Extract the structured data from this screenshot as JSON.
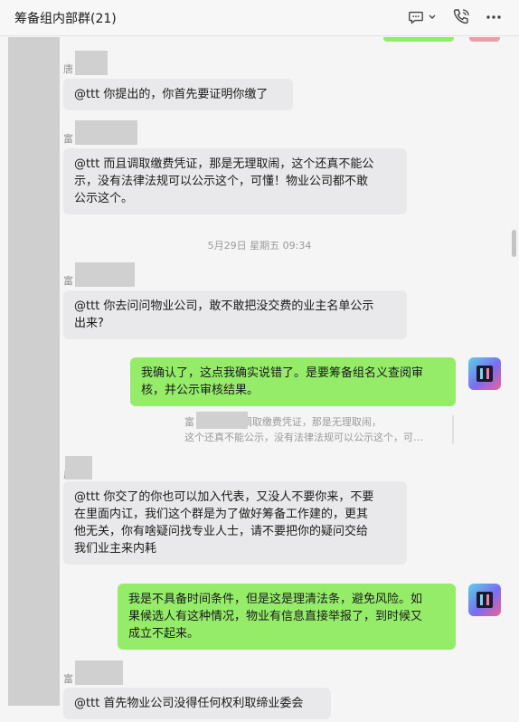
{
  "header": {
    "title": "筹备组内部群(21)"
  },
  "messages": {
    "m1": {
      "sender": "唐",
      "text": "@ttt 你提出的，你首先要证明你缴了"
    },
    "m2": {
      "sender": "富",
      "text": "@ttt 而且调取缴费凭证，那是无理取闹，这个还真不能公\n示，没有法律法规可以公示这个，可懂！物业公司都不敢\n公示这个。"
    },
    "ts": "5月29日 星期五 09:34",
    "m3": {
      "sender": "富",
      "text": "@ttt 你去问问物业公司，敢不敢把没交费的业主名单公示\n出来?"
    },
    "m4": {
      "text": "我确认了，这点我确实说错了。是要筹备组名义查阅审\n核，并公示审核结果。"
    },
    "q4": {
      "sender": "富",
      "text": "@ttt 而且调取缴费凭证，那是无理取闹，\n这个还真不能公示，没有法律法规可以公示这个，可…"
    },
    "m5": {
      "sender": "广",
      "text": "@ttt 你交了的你也可以加入代表，又没人不要你来，不要\n在里面内讧，我们这个群是为了做好筹备工作建的，更其\n他无关，你有啥疑问找专业人士，请不要把你的疑问交给\n我们业主来内耗"
    },
    "m6": {
      "text": "我是不具备时间条件，但是这是理清法条，避免风险。如\n果候选人有这种情况，物业有信息直接举报了，到时候又\n成立不起来。"
    },
    "m7": {
      "sender": "富",
      "text": "@ttt 首先物业公司没得任何权利取缔业委会"
    }
  },
  "colors": {
    "bubble_in": "#e9e9eb",
    "bubble_out": "#95ec69",
    "background": "#f5f5f5"
  },
  "icons": [
    "chat-bubble-icon",
    "chevron-down-icon",
    "phone-icon",
    "more-icon"
  ]
}
